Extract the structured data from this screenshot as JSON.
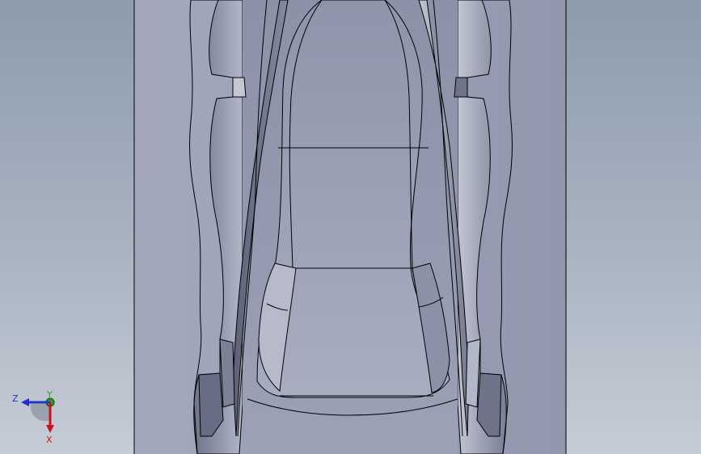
{
  "viewport": {
    "background_top": "#8d9bac",
    "background_bottom": "#c6ccd6",
    "model_face_color": "#9aa0b6",
    "model_edge_color": "#000000"
  },
  "triad": {
    "z_label": "Z",
    "y_label": "Y",
    "x_label": "X",
    "z_color": "#1f33c8",
    "y_color": "#2aa02a",
    "x_color": "#c81414"
  }
}
